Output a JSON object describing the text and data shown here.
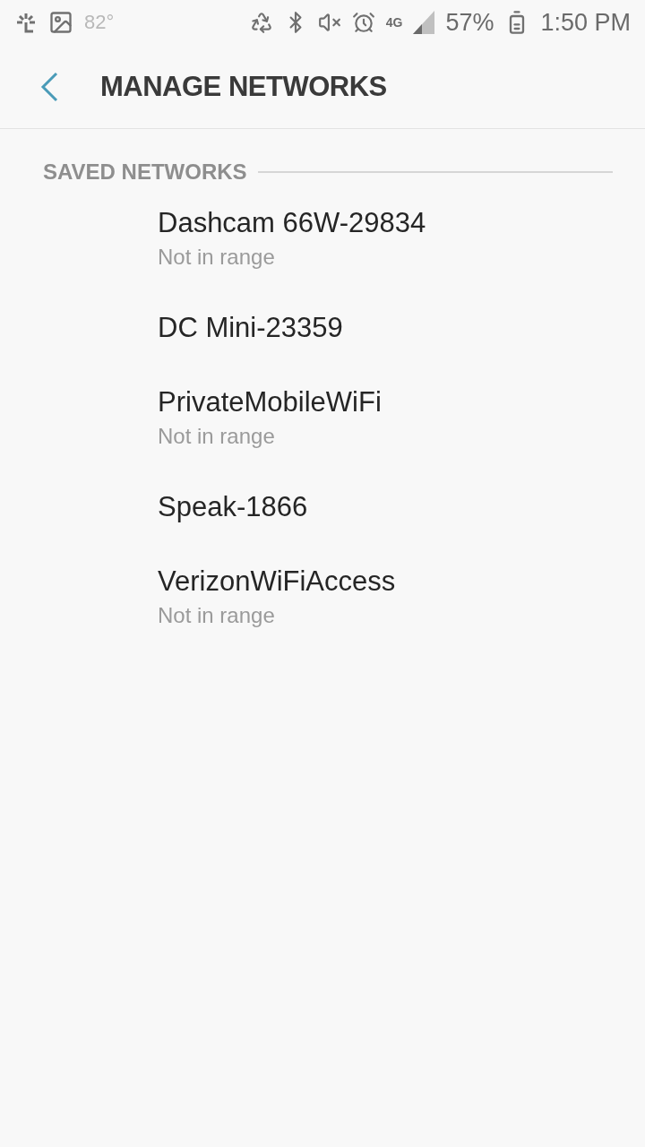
{
  "status_bar": {
    "temperature": "82°",
    "battery": "57%",
    "time": "1:50 PM",
    "network": "4G"
  },
  "header": {
    "title": "MANAGE NETWORKS"
  },
  "section": {
    "title": "SAVED NETWORKS"
  },
  "networks": [
    {
      "name": "Dashcam 66W-29834",
      "status": "Not in range"
    },
    {
      "name": "DC Mini-23359"
    },
    {
      "name": "PrivateMobileWiFi",
      "status": "Not in range"
    },
    {
      "name": "Speak-1866"
    },
    {
      "name": "VerizonWiFiAccess",
      "status": "Not in range"
    }
  ]
}
